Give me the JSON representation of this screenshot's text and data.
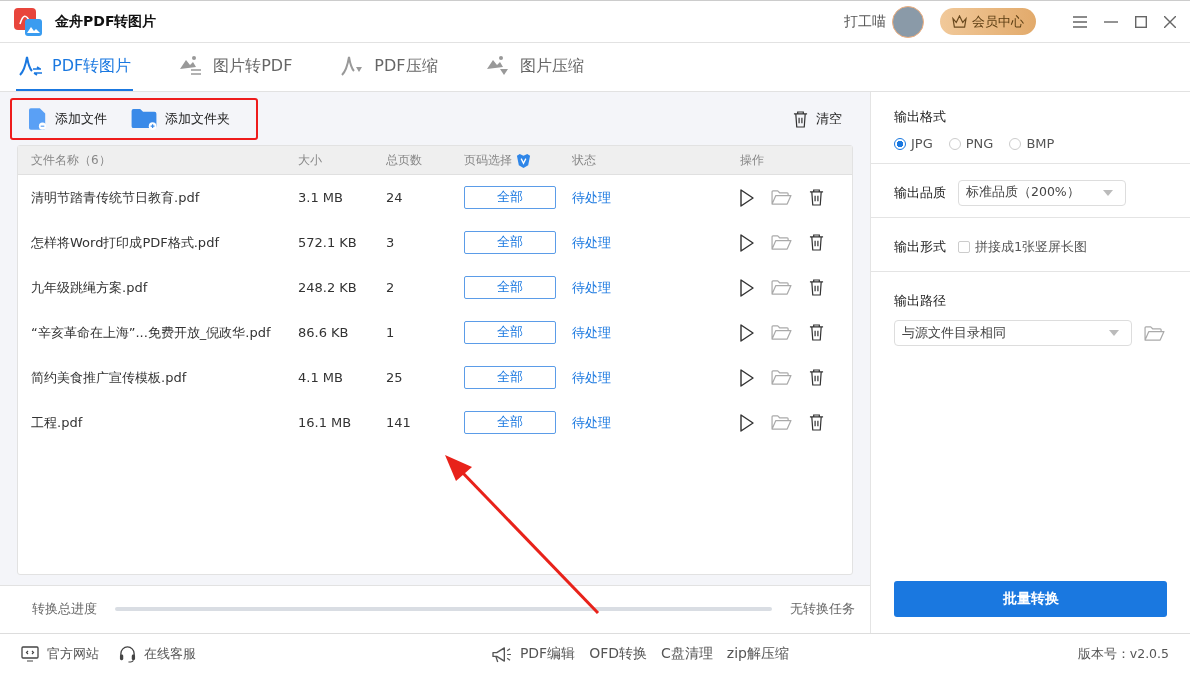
{
  "app": {
    "title": "金舟PDF转图片",
    "user_name": "打工喵"
  },
  "member_button": "会员中心",
  "tabs": [
    {
      "label": "PDF转图片",
      "selected": true,
      "kind": "pdf-image"
    },
    {
      "label": "图片转PDF",
      "selected": false,
      "kind": "image-pdf"
    },
    {
      "label": "PDF压缩",
      "selected": false,
      "kind": "pdf-compress"
    },
    {
      "label": "图片压缩",
      "selected": false,
      "kind": "image-compress"
    }
  ],
  "toolbar": {
    "add_file": "添加文件",
    "add_folder": "添加文件夹",
    "clear": "清空"
  },
  "table": {
    "columns": [
      "文件名称（6）",
      "大小",
      "总页数",
      "页码选择",
      "状态",
      "操作"
    ],
    "rows": [
      {
        "name": "清明节踏青传统节日教育.pdf",
        "size": "3.1 MB",
        "pages": "24",
        "page_range": "全部",
        "status": "待处理"
      },
      {
        "name": "怎样将Word打印成PDF格式.pdf",
        "size": "572.1 KB",
        "pages": "3",
        "page_range": "全部",
        "status": "待处理"
      },
      {
        "name": "九年级跳绳方案.pdf",
        "size": "248.2 KB",
        "pages": "2",
        "page_range": "全部",
        "status": "待处理"
      },
      {
        "name": "“辛亥革命在上海”...免费开放_倪政华.pdf",
        "size": "86.6 KB",
        "pages": "1",
        "page_range": "全部",
        "status": "待处理"
      },
      {
        "name": "简约美食推广宣传模板.pdf",
        "size": "4.1 MB",
        "pages": "25",
        "page_range": "全部",
        "status": "待处理"
      },
      {
        "name": "工程.pdf",
        "size": "16.1 MB",
        "pages": "141",
        "page_range": "全部",
        "status": "待处理"
      }
    ]
  },
  "progress": {
    "label": "转换总进度",
    "level": 0,
    "status": "无转换任务"
  },
  "settings": {
    "format": {
      "label": "输出格式",
      "options": [
        {
          "label": "JPG",
          "selected": true
        },
        {
          "label": "PNG",
          "selected": false
        },
        {
          "label": "BMP",
          "selected": false
        }
      ]
    },
    "quality": {
      "label": "输出品质",
      "value": "标准品质（200%）"
    },
    "form": {
      "label": "输出形式",
      "option": "拼接成1张竖屏长图",
      "checked": false
    },
    "path": {
      "label": "输出路径",
      "value": "与源文件目录相同"
    }
  },
  "convert_button": "批量转换",
  "footer": {
    "links": [
      {
        "label": "官方网站",
        "kind": "web"
      },
      {
        "label": "在线客服",
        "kind": "service"
      }
    ],
    "tools": [
      {
        "label": "PDF编辑",
        "icon": true
      },
      {
        "label": "OFD转换",
        "icon": false
      },
      {
        "label": "C盘清理",
        "icon": false
      },
      {
        "label": "zip解压缩",
        "icon": false
      }
    ],
    "version": "版本号：v2.0.5"
  }
}
